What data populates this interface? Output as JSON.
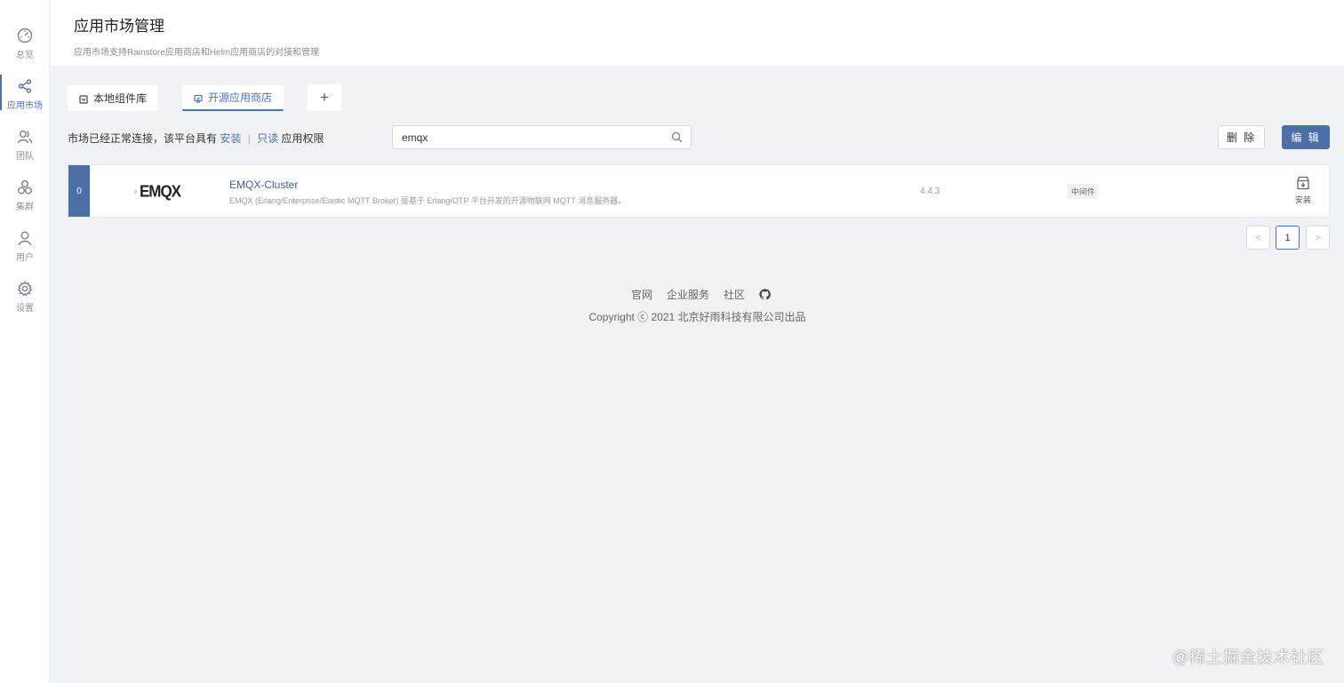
{
  "sidebar": {
    "items": [
      {
        "label": "总览",
        "icon": "dashboard-icon"
      },
      {
        "label": "应用市场",
        "icon": "share-icon"
      },
      {
        "label": "团队",
        "icon": "team-icon"
      },
      {
        "label": "集群",
        "icon": "cluster-icon"
      },
      {
        "label": "用户",
        "icon": "user-icon"
      },
      {
        "label": "设置",
        "icon": "gear-icon"
      }
    ],
    "active_index": 1
  },
  "header": {
    "title": "应用市场管理",
    "subtitle": "应用市场支持Rainstore应用商店和Helm应用商店的对接和管理"
  },
  "tabs": [
    {
      "label": "本地组件库",
      "icon": "box-icon"
    },
    {
      "label": "开源应用商店",
      "icon": "store-icon",
      "active": true
    },
    {
      "label": "+",
      "icon": "plus-icon"
    }
  ],
  "permission": {
    "prefix": "市场已经正常连接，该平台具有",
    "install": "安装",
    "separator": "|",
    "readonly": "只读",
    "suffix": "应用权限"
  },
  "search": {
    "value": "emqx",
    "placeholder": ""
  },
  "toolbar": {
    "delete_label": "删 除",
    "edit_label": "编 辑",
    "edit_color": "#4d6fa8"
  },
  "apps": [
    {
      "index": "0",
      "logo_text": "EMQX",
      "name": "EMQX-Cluster",
      "description": "EMQX (Erlang/Enterprise/Elastic MQTT Broker) 是基于 Erlang/OTP 平台开发的开源物联网 MQTT 消息服务器。",
      "version": "4.4.3",
      "tag": "中间件",
      "action_label": "安装"
    }
  ],
  "pagination": {
    "prev": "<",
    "current": "1",
    "next": ">"
  },
  "footer": {
    "links": [
      "官网",
      "企业服务",
      "社区"
    ],
    "copyright": "Copyright ⓒ 2021 北京好雨科技有限公司出品"
  },
  "watermark": "@稀土掘金技术社区"
}
